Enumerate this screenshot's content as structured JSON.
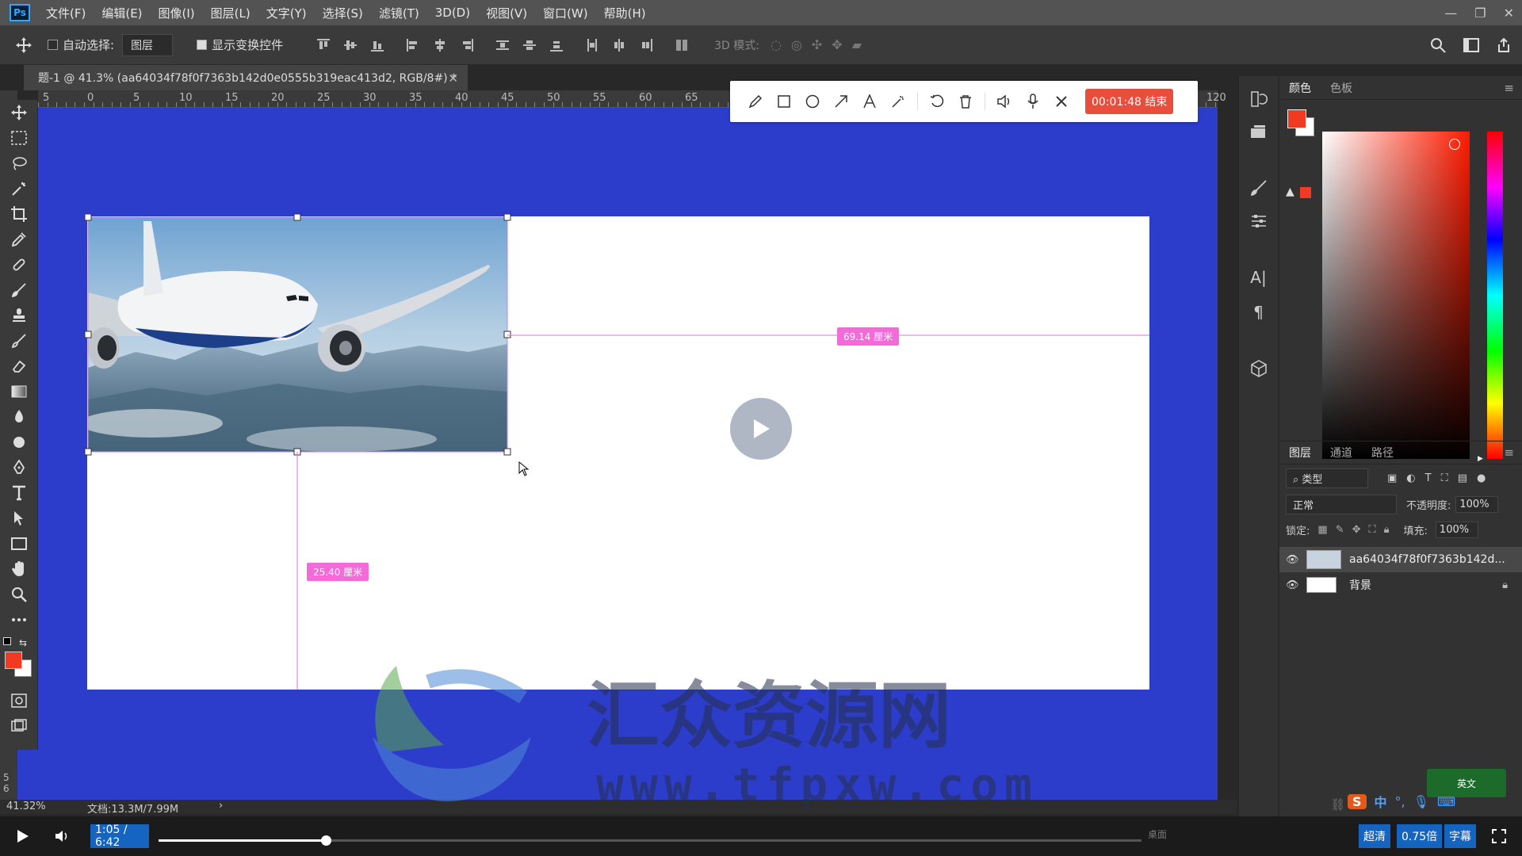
{
  "menubar": {
    "logo": "Ps",
    "items": [
      "文件(F)",
      "编辑(E)",
      "图像(I)",
      "图层(L)",
      "文字(Y)",
      "选择(S)",
      "滤镜(T)",
      "3D(D)",
      "视图(V)",
      "窗口(W)",
      "帮助(H)"
    ]
  },
  "options": {
    "auto_select_label": "自动选择:",
    "auto_select_checked": false,
    "auto_select_target": "图层",
    "show_transform_label": "显示变换控件",
    "show_transform_checked": true,
    "mode_3d_label": "3D 模式:"
  },
  "document": {
    "tab_title": "题-1 @ 41.3% (aa64034f78f0f7363b142d0e0555b319eac413d2, RGB/8#) *",
    "zoom": "41.32%",
    "doc_size": "文档:13.3M/7.99M"
  },
  "ruler": {
    "top_labels": [
      "5",
      "0",
      "5",
      "10",
      "15",
      "20",
      "25",
      "30",
      "35",
      "40",
      "45",
      "50",
      "55",
      "60",
      "65",
      "120"
    ],
    "left_labels": [
      "5",
      "6"
    ]
  },
  "annotation_bar": {
    "tools": [
      "pencil-icon",
      "rectangle-icon",
      "ellipse-icon",
      "arrow-icon",
      "text-icon",
      "magic-icon",
      "undo-icon",
      "delete-icon",
      "speaker-icon",
      "microphone-icon",
      "close-icon"
    ],
    "record_label": "00:01:48 结束"
  },
  "measurements": {
    "horizontal": "69.14 厘米",
    "vertical": "25.40 厘米"
  },
  "color_panel": {
    "tabs": [
      "颜色",
      "色板"
    ],
    "foreground": "#f03a22",
    "background": "#ffffff"
  },
  "layers_panel": {
    "tabs": [
      "图层",
      "通道",
      "路径"
    ],
    "filter_label": "类型",
    "blend_mode": "正常",
    "opacity_label": "不透明度:",
    "opacity_value": "100%",
    "lock_label": "锁定:",
    "fill_label": "填充:",
    "fill_value": "100%",
    "layers": [
      {
        "name": "aa64034f78f0f7363b142d...",
        "visible": true,
        "locked": false,
        "selected": true
      },
      {
        "name": "背景",
        "visible": true,
        "locked": true,
        "selected": false
      }
    ]
  },
  "video": {
    "time": "1:05 / 6:42",
    "progress": 0.17,
    "quality": "超清",
    "speed": "0.75倍",
    "subtitle": "字幕",
    "desktop_label": "桌面"
  },
  "ime": {
    "lang": "英文",
    "mode": "中"
  },
  "watermark": {
    "title": "汇众资源网",
    "url": "www.tfpxw.com"
  },
  "colors": {
    "workspace_blue": "#2d3dcb",
    "accent_magenta": "#f26bd8",
    "record_red": "#e84e3b"
  }
}
